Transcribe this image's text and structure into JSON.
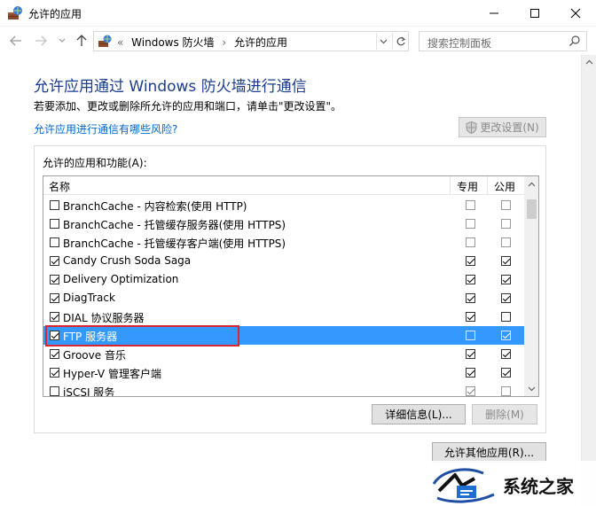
{
  "window": {
    "title": "允许的应用"
  },
  "address": {
    "overflow": "«",
    "crumbs": [
      "Windows 防火墙",
      "允许的应用"
    ],
    "search_placeholder": "搜索控制面板"
  },
  "content": {
    "heading": "允许应用通过 Windows 防火墙进行通信",
    "description": "若要添加、更改或删除所允许的应用和端口，请单击\"更改设置\"。",
    "risk_link": "允许应用进行通信有哪些风险?",
    "change_settings_label": "更改设置(N)",
    "group_label": "允许的应用和功能(A):",
    "columns": {
      "name": "名称",
      "private": "专用",
      "public": "公用"
    },
    "apps": [
      {
        "name": "BranchCache - 内容检索(使用 HTTP)",
        "enabled": false,
        "private": false,
        "public": false
      },
      {
        "name": "BranchCache - 托管缓存服务器(使用 HTTPS)",
        "enabled": false,
        "private": false,
        "public": false
      },
      {
        "name": "BranchCache - 托管缓存客户端(使用 HTTPS)",
        "enabled": false,
        "private": false,
        "public": false
      },
      {
        "name": "Candy Crush Soda Saga",
        "enabled": true,
        "private": true,
        "public": true
      },
      {
        "name": "Delivery Optimization",
        "enabled": true,
        "private": true,
        "public": true
      },
      {
        "name": "DiagTrack",
        "enabled": true,
        "private": true,
        "public": true
      },
      {
        "name": "DIAL 协议服务器",
        "enabled": true,
        "private": true,
        "public": false
      },
      {
        "name": "FTP 服务器",
        "enabled": true,
        "private": false,
        "public": true,
        "selected": true
      },
      {
        "name": "Groove 音乐",
        "enabled": true,
        "private": true,
        "public": true
      },
      {
        "name": "Hyper-V 管理客户端",
        "enabled": true,
        "private": true,
        "public": true
      },
      {
        "name": "iSCSI 服务",
        "enabled": false,
        "private": true,
        "public": false
      }
    ],
    "details_label": "详细信息(L)...",
    "delete_label": "删除(M)",
    "allow_other_label": "允许其他应用(R)..."
  },
  "watermark": {
    "text": "系统之家"
  },
  "colors": {
    "selection": "#3399ff",
    "heading": "#1a3e8c",
    "link": "#0066cc",
    "highlight": "#d9262f"
  }
}
